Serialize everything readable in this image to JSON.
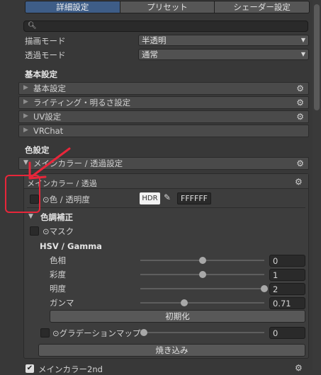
{
  "tabs": [
    {
      "label": "詳細設定",
      "active": true
    },
    {
      "label": "プリセット",
      "active": false
    },
    {
      "label": "シェーダー設定",
      "active": false
    }
  ],
  "search": {
    "value": ""
  },
  "render_mode": {
    "label": "描画モード",
    "value": "半透明"
  },
  "transparent_mode": {
    "label": "透過モード",
    "value": "通常"
  },
  "basic_section": {
    "title": "基本設定",
    "folds": [
      "基本設定",
      "ライティング・明るさ設定",
      "UV設定",
      "VRChat"
    ]
  },
  "color_section": {
    "title": "色設定",
    "main_fold": "メインカラー / 透過設定"
  },
  "panel": {
    "title": "メインカラー / 透過",
    "color_label": "⊙色 / 透明度",
    "hdr": "HDR",
    "hex": "FFFFFF",
    "correction_label": "色調補正",
    "mask_label": "⊙マスク",
    "hsv_title": "HSV / Gamma",
    "sliders": [
      {
        "label": "色相",
        "value": "0",
        "fraction": 0.5
      },
      {
        "label": "彩度",
        "value": "1",
        "fraction": 0.5
      },
      {
        "label": "明度",
        "value": "2",
        "fraction": 1.0
      },
      {
        "label": "ガンマ",
        "value": "0.71",
        "fraction": 0.355
      }
    ],
    "reset_label": "初期化",
    "gradient_label": "⊙グラデーションマップ",
    "gradient_value": "0",
    "gradient_fraction": 0.0,
    "bake_label": "焼き込み"
  },
  "next_item": {
    "label": "メインカラー2nd"
  },
  "annotation_colors": {
    "red": "#e8263a"
  }
}
